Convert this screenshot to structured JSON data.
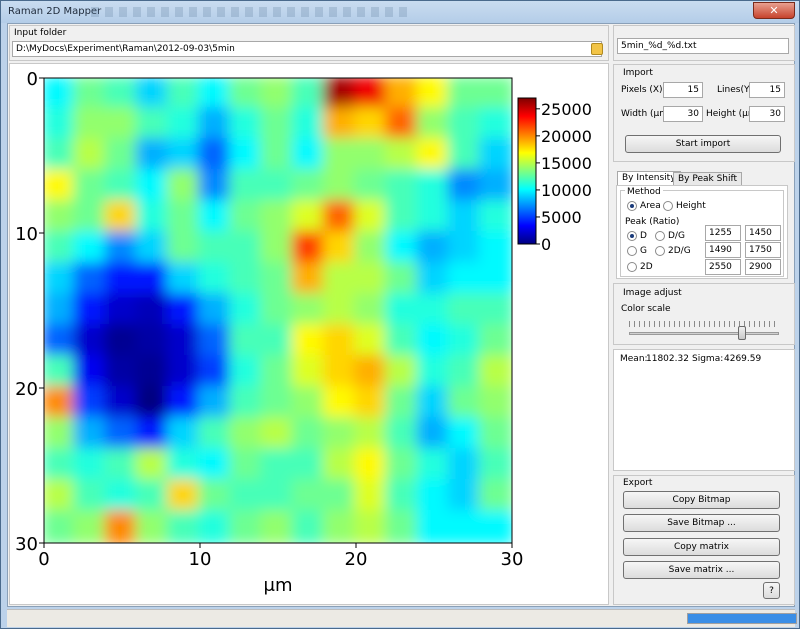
{
  "window": {
    "title": "Raman 2D Mapper",
    "close_glyph": "✕"
  },
  "input": {
    "folder_label": "Input folder",
    "folder_path": "D:\\MyDocs\\Experiment\\Raman\\2012-09-03\\5min",
    "file_pattern": "5min_%d_%d.txt"
  },
  "import": {
    "title": "Import",
    "pixels_x_label": "Pixels (X)",
    "pixels_x": "15",
    "lines_y_label": "Lines(Y)",
    "lines_y": "15",
    "width_label": "Width (μm)",
    "width": "30",
    "height_label": "Height (μm)",
    "height": "30",
    "start_button": "Start import"
  },
  "tabs": [
    {
      "label": "By Intensity",
      "active": true
    },
    {
      "label": "By Peak Shift",
      "active": false
    }
  ],
  "method": {
    "title": "Method",
    "options": [
      {
        "label": "Area",
        "selected": true
      },
      {
        "label": "Height",
        "selected": false
      }
    ]
  },
  "peak": {
    "title": "Peak (Ratio)",
    "options": [
      {
        "label": "D",
        "selected": true
      },
      {
        "label": "D/G",
        "selected": false
      },
      {
        "label": "G",
        "selected": false
      },
      {
        "label": "2D/G",
        "selected": false
      },
      {
        "label": "2D",
        "selected": false
      }
    ],
    "ranges": [
      [
        "1255",
        "1450"
      ],
      [
        "1490",
        "1750"
      ],
      [
        "2550",
        "2900"
      ]
    ]
  },
  "image_adjust": {
    "title": "Image adjust",
    "color_scale_label": "Color scale",
    "slider_value": 0.75
  },
  "stats": {
    "mean_label": "Mean:",
    "mean": "11802.32",
    "sigma_label": "Sigma:",
    "sigma": "4269.59"
  },
  "export": {
    "title": "Export",
    "buttons": {
      "copy_bitmap": "Copy Bitmap",
      "save_bitmap": "Save Bitmap ...",
      "copy_matrix": "Copy matrix",
      "save_matrix": "Save matrix ...",
      "help": "?"
    }
  },
  "status": {
    "progress": 1.0
  },
  "chart_data": {
    "type": "heatmap",
    "xlabel": "μm",
    "x_ticks": [
      "0",
      "10",
      "20",
      "30"
    ],
    "y_ticks": [
      "0",
      "10",
      "20",
      "30"
    ],
    "xlim": [
      0,
      30
    ],
    "ylim": [
      0,
      30
    ],
    "colormap": "jet",
    "colorbar_ticks": [
      "25000",
      "20000",
      "15000",
      "10000",
      "5000",
      "0"
    ],
    "zlim": [
      0,
      27000
    ],
    "grid_size": [
      15,
      15
    ],
    "values": [
      [
        10000,
        13000,
        12000,
        9000,
        12000,
        10000,
        13000,
        14000,
        12000,
        26000,
        24000,
        19000,
        17000,
        13000,
        13000
      ],
      [
        11000,
        14000,
        14000,
        12000,
        11000,
        8000,
        11000,
        13000,
        11000,
        19000,
        18000,
        21000,
        14000,
        12000,
        11000
      ],
      [
        12000,
        15000,
        13000,
        8000,
        9000,
        6000,
        10000,
        13000,
        10000,
        14000,
        14000,
        15000,
        17000,
        12000,
        9000
      ],
      [
        17000,
        13000,
        12000,
        10000,
        14000,
        7000,
        12000,
        12000,
        13000,
        14000,
        13000,
        12000,
        11000,
        7000,
        8000
      ],
      [
        14000,
        13000,
        18000,
        11000,
        13000,
        10000,
        13000,
        14000,
        16000,
        21000,
        16000,
        12000,
        11000,
        9000,
        11000
      ],
      [
        12000,
        10000,
        7000,
        9000,
        13000,
        12000,
        12000,
        14000,
        22000,
        18000,
        14000,
        10000,
        8000,
        9000,
        10000
      ],
      [
        9000,
        6000,
        4000,
        4000,
        9000,
        11000,
        12000,
        13000,
        19000,
        15000,
        15000,
        13000,
        9000,
        10000,
        10000
      ],
      [
        8000,
        4000,
        2000,
        1500,
        4000,
        8000,
        11000,
        13000,
        14000,
        15000,
        14000,
        11000,
        11000,
        12000,
        12000
      ],
      [
        6000,
        2000,
        500,
        1000,
        2000,
        6000,
        12000,
        12000,
        17000,
        18000,
        16000,
        12000,
        10000,
        11000,
        13000
      ],
      [
        12000,
        3000,
        1000,
        500,
        2000,
        5000,
        11000,
        13000,
        16000,
        18000,
        19000,
        15000,
        11000,
        12000,
        15000
      ],
      [
        20000,
        5000,
        2000,
        0,
        4000,
        8000,
        12000,
        13000,
        14000,
        17000,
        18000,
        13000,
        9000,
        13000,
        14000
      ],
      [
        14000,
        8000,
        6000,
        4000,
        9000,
        12000,
        14000,
        15000,
        13000,
        14000,
        15000,
        12000,
        8000,
        10000,
        13000
      ],
      [
        12000,
        11000,
        12000,
        15000,
        11000,
        10000,
        13000,
        12000,
        12000,
        15000,
        17000,
        13000,
        11000,
        9000,
        12000
      ],
      [
        15000,
        12000,
        11000,
        12000,
        18000,
        13000,
        12000,
        12000,
        13000,
        13000,
        16000,
        12000,
        10000,
        9000,
        13000
      ],
      [
        13000,
        14000,
        20000,
        14000,
        12000,
        11000,
        13000,
        14000,
        12000,
        14000,
        15000,
        13000,
        10000,
        10000,
        10000
      ]
    ]
  }
}
